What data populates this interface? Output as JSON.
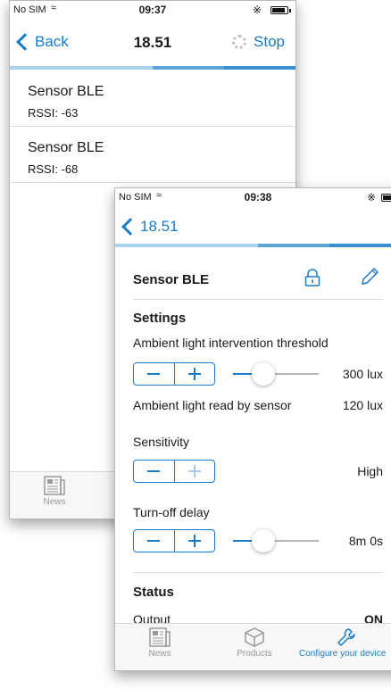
{
  "back_screen": {
    "status": {
      "carrier": "No SIM",
      "time": "09:37"
    },
    "nav": {
      "back_label": "Back",
      "title": "18.51",
      "stop_label": "Stop"
    },
    "devices": [
      {
        "name": "Sensor BLE",
        "rssi": "RSSI: -63"
      },
      {
        "name": "Sensor BLE",
        "rssi": "RSSI: -68"
      }
    ],
    "tabs": [
      {
        "label": "News"
      }
    ]
  },
  "front_screen": {
    "status": {
      "carrier": "No SIM",
      "time": "09:38"
    },
    "nav": {
      "back_label": "18.51"
    },
    "device": {
      "name": "Sensor BLE"
    },
    "settings": {
      "title": "Settings",
      "threshold": {
        "label": "Ambient light intervention threshold",
        "value": "300 lux",
        "slider_fraction": 0.35
      },
      "read": {
        "label": "Ambient light read by sensor",
        "value": "120 lux"
      },
      "sensitivity": {
        "label": "Sensitivity",
        "value": "High"
      },
      "delay": {
        "label": "Turn-off delay",
        "value": "8m 0s",
        "slider_fraction": 0.35
      }
    },
    "status_section": {
      "title": "Status",
      "output_label": "Output",
      "output_value": "ON"
    },
    "tabs": [
      {
        "label": "News"
      },
      {
        "label": "Products"
      },
      {
        "label": "Configure your device"
      }
    ]
  },
  "colors": {
    "accent": "#1a7cc9",
    "progress_light": "#a9d3ee",
    "progress_dark": "#3a8fce"
  }
}
